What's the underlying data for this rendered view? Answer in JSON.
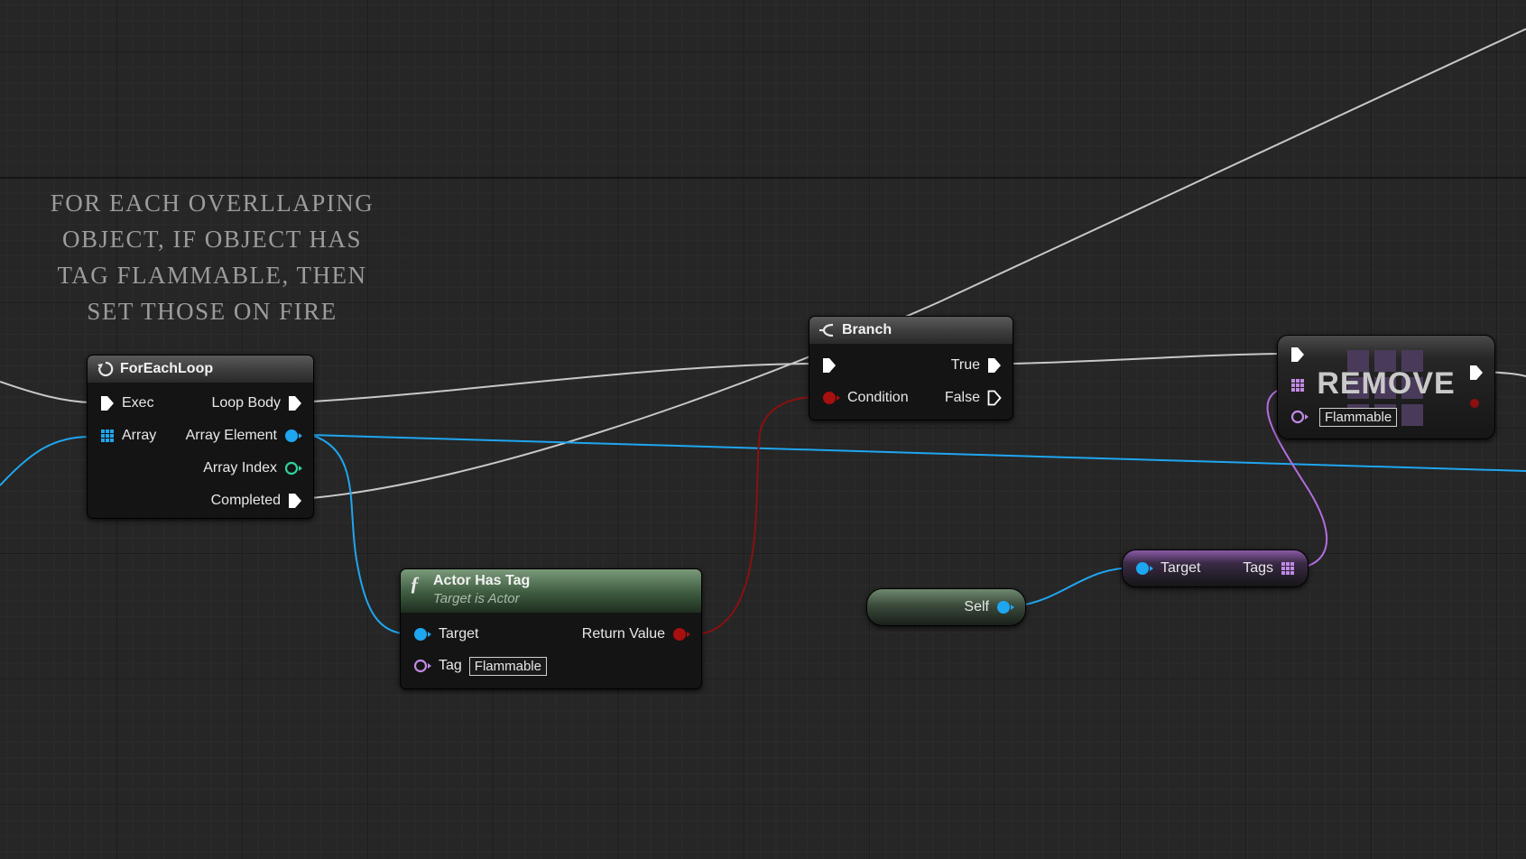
{
  "comment": {
    "line1": "For each overllaping",
    "line2": "object, if object has",
    "line3": "tag flammable, then",
    "line4": "set those on fire"
  },
  "foreach": {
    "title": "ForEachLoop",
    "exec": "Exec",
    "array": "Array",
    "loop_body": "Loop Body",
    "array_element": "Array Element",
    "array_index": "Array Index",
    "completed": "Completed"
  },
  "branch": {
    "title": "Branch",
    "condition": "Condition",
    "true_label": "True",
    "false_label": "False"
  },
  "actor_has_tag": {
    "title": "Actor Has Tag",
    "subtitle": "Target is Actor",
    "target": "Target",
    "tag": "Tag",
    "tag_value": "Flammable",
    "return_value": "Return Value"
  },
  "self_node": {
    "label": "Self"
  },
  "tags_node": {
    "target": "Target",
    "tags": "Tags"
  },
  "remove_node": {
    "title": "REMOVE",
    "value": "Flammable"
  },
  "colors": {
    "exec": "#ffffff",
    "object": "#1fa6f0",
    "boolean": "#a80f0f",
    "name": "#c18ae6",
    "integer": "#2fd49a",
    "wire_exec": "#c8c8c8"
  }
}
